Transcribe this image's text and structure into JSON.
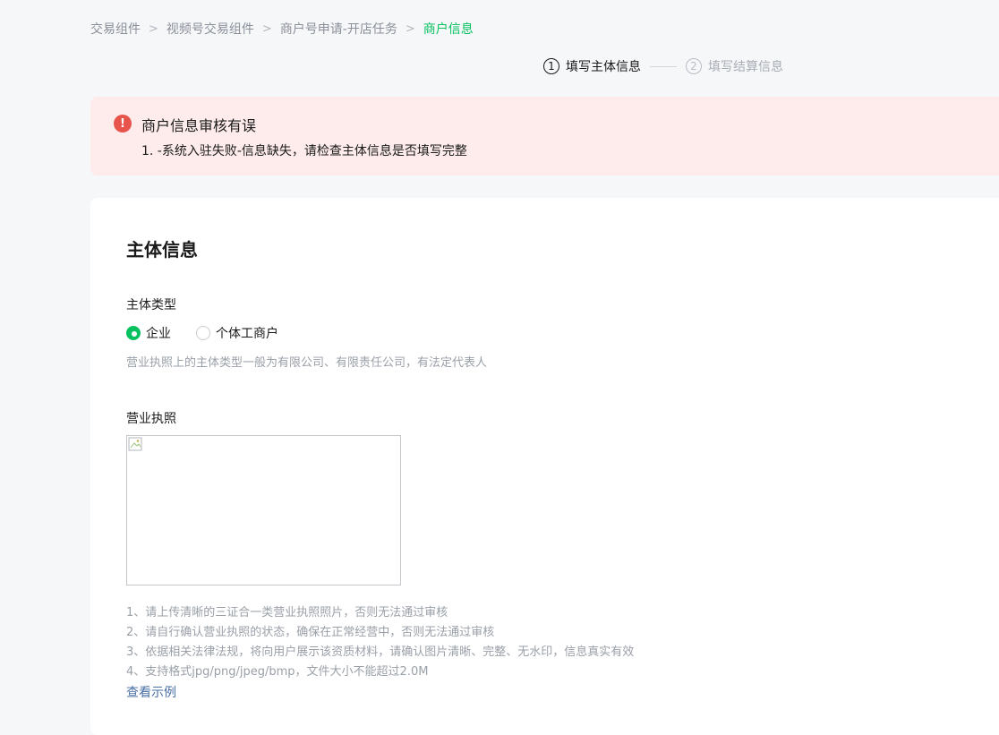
{
  "breadcrumb": {
    "items": [
      "交易组件",
      "视频号交易组件",
      "商户号申请-开店任务"
    ],
    "current": "商户信息",
    "separator": ">"
  },
  "steps": [
    {
      "num": "1",
      "label": "填写主体信息",
      "active": true
    },
    {
      "num": "2",
      "label": "填写结算信息",
      "active": false
    }
  ],
  "alert": {
    "icon": "!",
    "title": "商户信息审核有误",
    "message": "1. -系统入驻失败-信息缺失，请检查主体信息是否填写完整",
    "color": "#e8534c"
  },
  "form": {
    "section_title": "主体信息",
    "entity_type": {
      "label": "主体类型",
      "options": [
        {
          "label": "企业",
          "checked": true
        },
        {
          "label": "个体工商户",
          "checked": false
        }
      ],
      "hint": "营业执照上的主体类型一般为有限公司、有限责任公司，有法定代表人"
    },
    "license": {
      "label": "营业执照",
      "notes": [
        "1、请上传清晰的三证合一类营业执照照片，否则无法通过审核",
        "2、请自行确认营业执照的状态，确保在正常经营中，否则无法通过审核",
        "3、依据相关法律法规，将向用户展示该资质材料，请确认图片清晰、完整、无水印，信息真实有效",
        "4、支持格式jpg/png/jpeg/bmp，文件大小不能超过2.0M"
      ],
      "example_link": "查看示例"
    }
  },
  "colors": {
    "accent": "#07c160",
    "alert_bg": "#fdeceb",
    "link": "#4a6fa5"
  }
}
